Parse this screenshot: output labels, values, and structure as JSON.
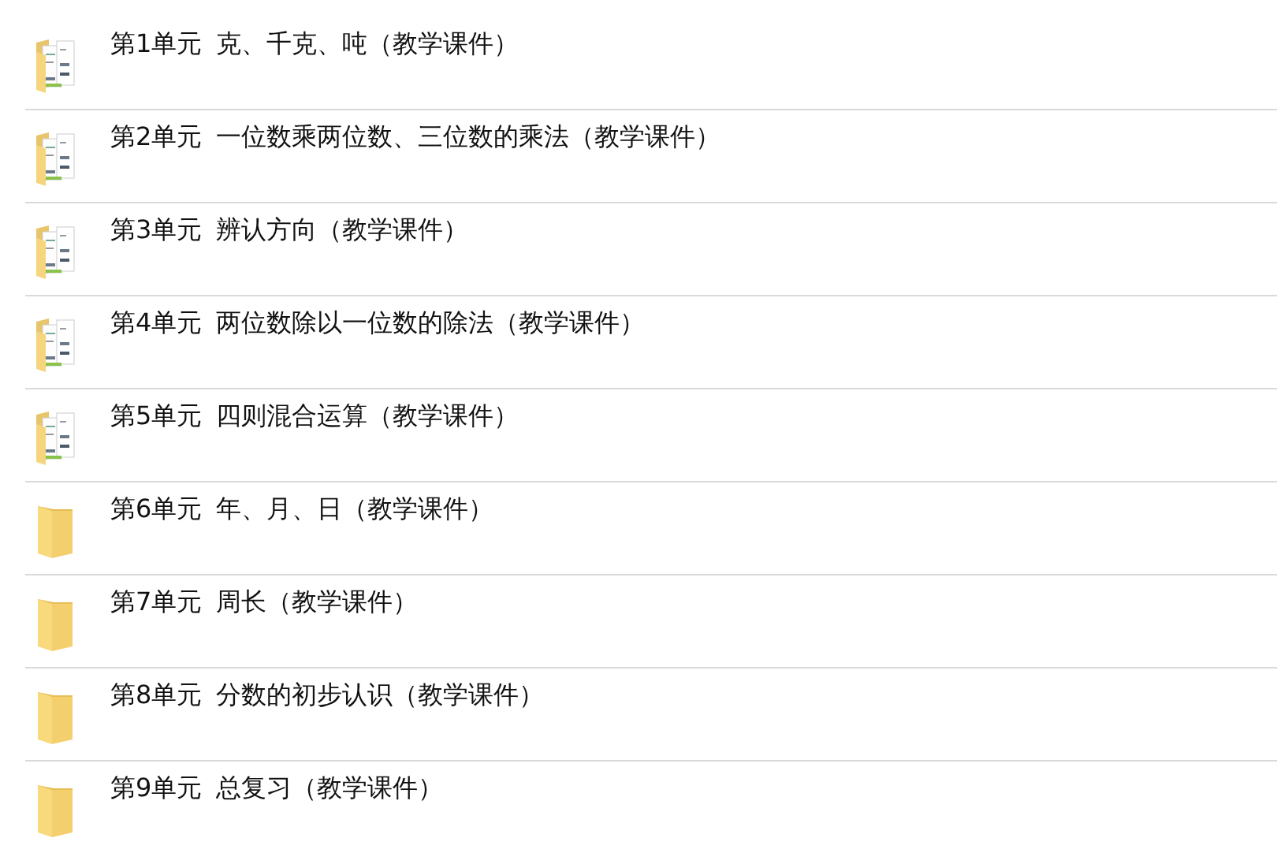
{
  "folders": [
    {
      "kind": "documents",
      "unit": "第1单元",
      "title": "克、千克、吨（教学课件）"
    },
    {
      "kind": "documents",
      "unit": "第2单元",
      "title": "一位数乘两位数、三位数的乘法（教学课件）"
    },
    {
      "kind": "documents",
      "unit": "第3单元",
      "title": "辨认方向（教学课件）"
    },
    {
      "kind": "documents",
      "unit": "第4单元",
      "title": "两位数除以一位数的除法（教学课件）"
    },
    {
      "kind": "documents",
      "unit": "第5单元",
      "title": "四则混合运算（教学课件）"
    },
    {
      "kind": "empty",
      "unit": "第6单元",
      "title": "年、月、日（教学课件）"
    },
    {
      "kind": "empty",
      "unit": "第7单元",
      "title": "周长（教学课件）"
    },
    {
      "kind": "empty",
      "unit": "第8单元",
      "title": "分数的初步认识（教学课件）"
    },
    {
      "kind": "empty",
      "unit": "第9单元",
      "title": "总复习（教学课件）"
    }
  ]
}
